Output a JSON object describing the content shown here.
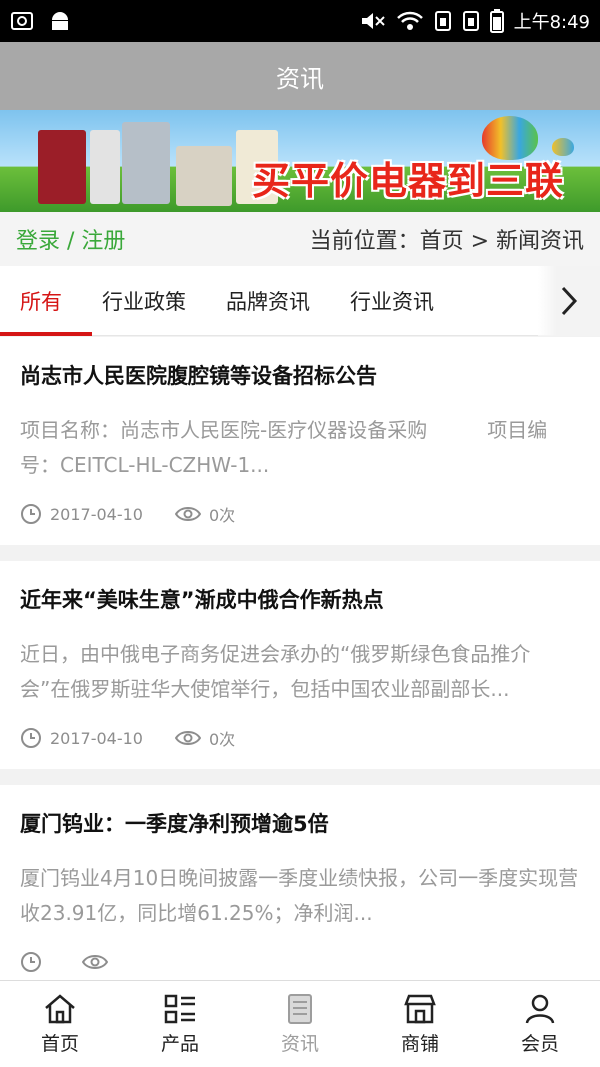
{
  "status": {
    "time": "上午8:49"
  },
  "appbar": {
    "title": "资讯"
  },
  "banner": {
    "slogan": "买平价电器到三联"
  },
  "crumb": {
    "login": "登录 / 注册",
    "path": "当前位置：首页 > 新闻资讯"
  },
  "tabs": [
    {
      "label": "所有"
    },
    {
      "label": "行业政策"
    },
    {
      "label": "品牌资讯"
    },
    {
      "label": "行业资讯"
    }
  ],
  "articles": [
    {
      "title": "尚志市人民医院腹腔镜等设备招标公告",
      "summary": "项目名称：尚志市人民医院-医疗仪器设备采购　　　项目编号：CEITCL-HL-CZHW-1...",
      "date": "2017-04-10",
      "views": "0次"
    },
    {
      "title": "近年来“美味生意”渐成中俄合作新热点",
      "summary": "近日，由中俄电子商务促进会承办的“俄罗斯绿色食品推介会”在俄罗斯驻华大使馆举行，包括中国农业部副部长...",
      "date": "2017-04-10",
      "views": "0次"
    },
    {
      "title": "厦门钨业：一季度净利预增逾5倍",
      "summary": "厦门钨业4月10日晚间披露一季度业绩快报，公司一季度实现营收23.91亿，同比增61.25%；净利润...",
      "date": "",
      "views": ""
    }
  ],
  "tabbar": [
    {
      "label": "首页",
      "icon": "home-icon"
    },
    {
      "label": "产品",
      "icon": "list-icon"
    },
    {
      "label": "资讯",
      "icon": "news-icon"
    },
    {
      "label": "商铺",
      "icon": "shop-icon"
    },
    {
      "label": "会员",
      "icon": "user-icon"
    }
  ],
  "colors": {
    "accent": "#d51515",
    "login": "#3aa83a",
    "appbar": "#a8a8a8"
  }
}
